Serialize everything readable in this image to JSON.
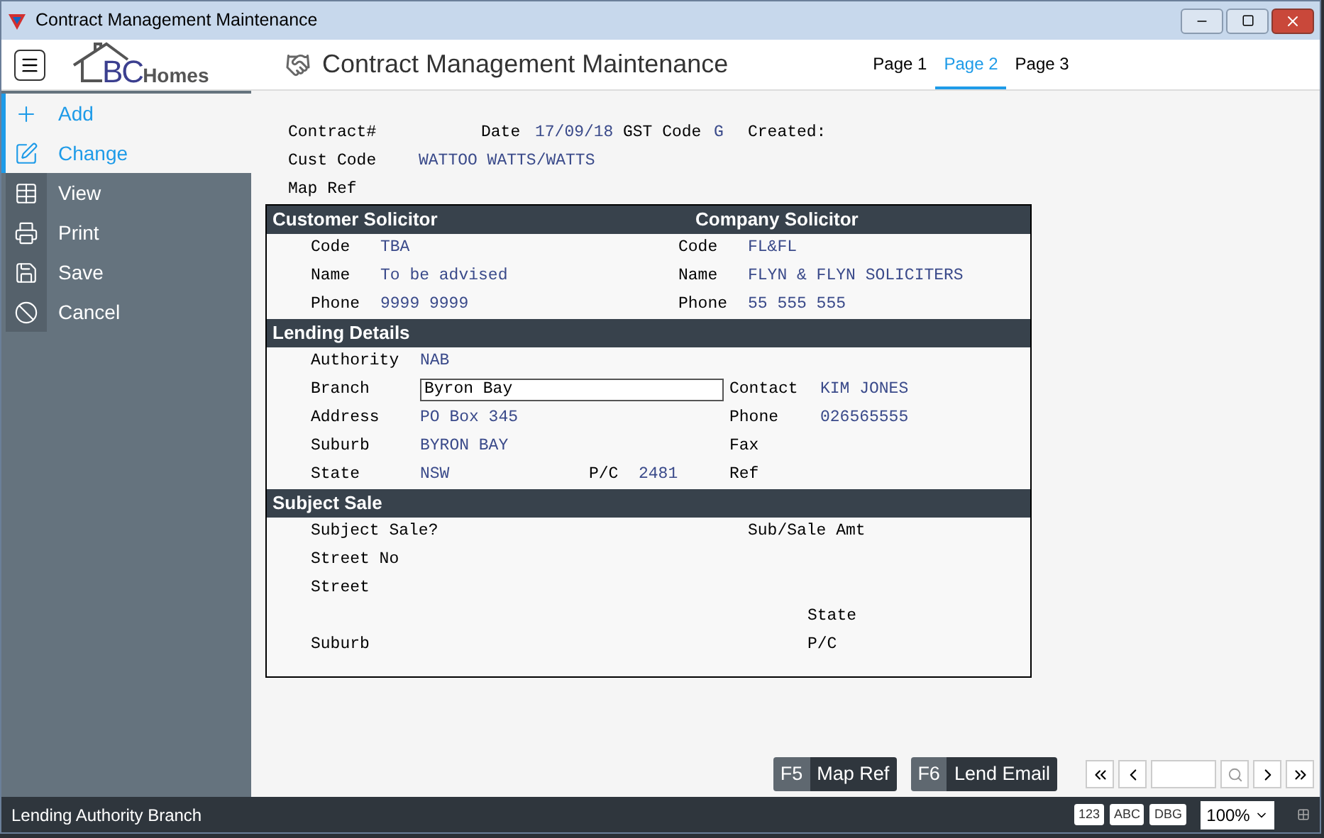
{
  "window": {
    "title": "Contract Management Maintenance"
  },
  "header": {
    "logo_letters": "BC",
    "logo_word": "Homes",
    "title": "Contract Management Maintenance"
  },
  "tabs": [
    {
      "label": "Page 1",
      "selected": false
    },
    {
      "label": "Page 2",
      "selected": true
    },
    {
      "label": "Page 3",
      "selected": false
    }
  ],
  "sidebar": {
    "items": [
      {
        "label": "Add",
        "kind": "add",
        "enabled": true
      },
      {
        "label": "Change",
        "kind": "change",
        "enabled": true
      },
      {
        "label": "View",
        "kind": "view",
        "enabled": false
      },
      {
        "label": "Print",
        "kind": "print",
        "enabled": false
      },
      {
        "label": "Save",
        "kind": "save",
        "enabled": false
      },
      {
        "label": "Cancel",
        "kind": "cancel",
        "enabled": false
      }
    ]
  },
  "top_fields": {
    "contract_label": "Contract#",
    "date_label": "Date",
    "date": "17/09/18",
    "gst_label": "GST Code",
    "gst": "G",
    "created_label": "Created:",
    "cust_label": "Cust Code",
    "cust": "WATTOO WATTS/WATTS",
    "map_label": "Map Ref"
  },
  "solicitors": {
    "left_title": "Customer Solicitor",
    "right_title": "Company Solicitor",
    "rows": [
      {
        "left_label": "Code",
        "left_value": "TBA",
        "right_label": "Code",
        "right_value": "FL&FL"
      },
      {
        "left_label": "Name",
        "left_value": "To be advised",
        "right_label": "Name",
        "right_value": "FLYN & FLYN SOLICITERS"
      },
      {
        "left_label": "Phone",
        "left_value": "9999 9999",
        "right_label": "Phone",
        "right_value": "55 555 555"
      }
    ]
  },
  "lending": {
    "title": "Lending Details",
    "rows": [
      {
        "label": "Authority",
        "value": "NAB",
        "kind": "text"
      },
      {
        "label": "Branch",
        "value": "Byron Bay",
        "kind": "input",
        "right_label": "Contact",
        "right_value": "KIM JONES"
      },
      {
        "label": "Address",
        "value": "PO Box 345",
        "kind": "text",
        "right_label": "Phone",
        "right_value": "026565555"
      },
      {
        "label": "Suburb",
        "value": "BYRON BAY",
        "kind": "text",
        "right_label": "Fax"
      },
      {
        "label": "State",
        "value": "NSW",
        "kind": "text",
        "mid_label": "P/C",
        "mid_value": "2481",
        "right_label": "Ref"
      }
    ]
  },
  "subject_sale": {
    "title": "Subject Sale",
    "rows": [
      {
        "label": "Subject Sale?",
        "side_label": "Sub/Sale Amt",
        "kind": "near"
      },
      {
        "label": "Street No"
      },
      {
        "label": "Street"
      },
      {
        "side_label": "State",
        "kind": "far"
      },
      {
        "label": "Suburb",
        "side_label": "P/C",
        "kind": "far"
      }
    ]
  },
  "function_buttons": [
    {
      "key": "F5",
      "label": "Map Ref"
    },
    {
      "key": "F6",
      "label": "Lend Email"
    }
  ],
  "status_bar": {
    "text": "Lending Authority Branch",
    "badges": [
      "123",
      "ABC",
      "DBG"
    ],
    "zoom": "100%"
  }
}
